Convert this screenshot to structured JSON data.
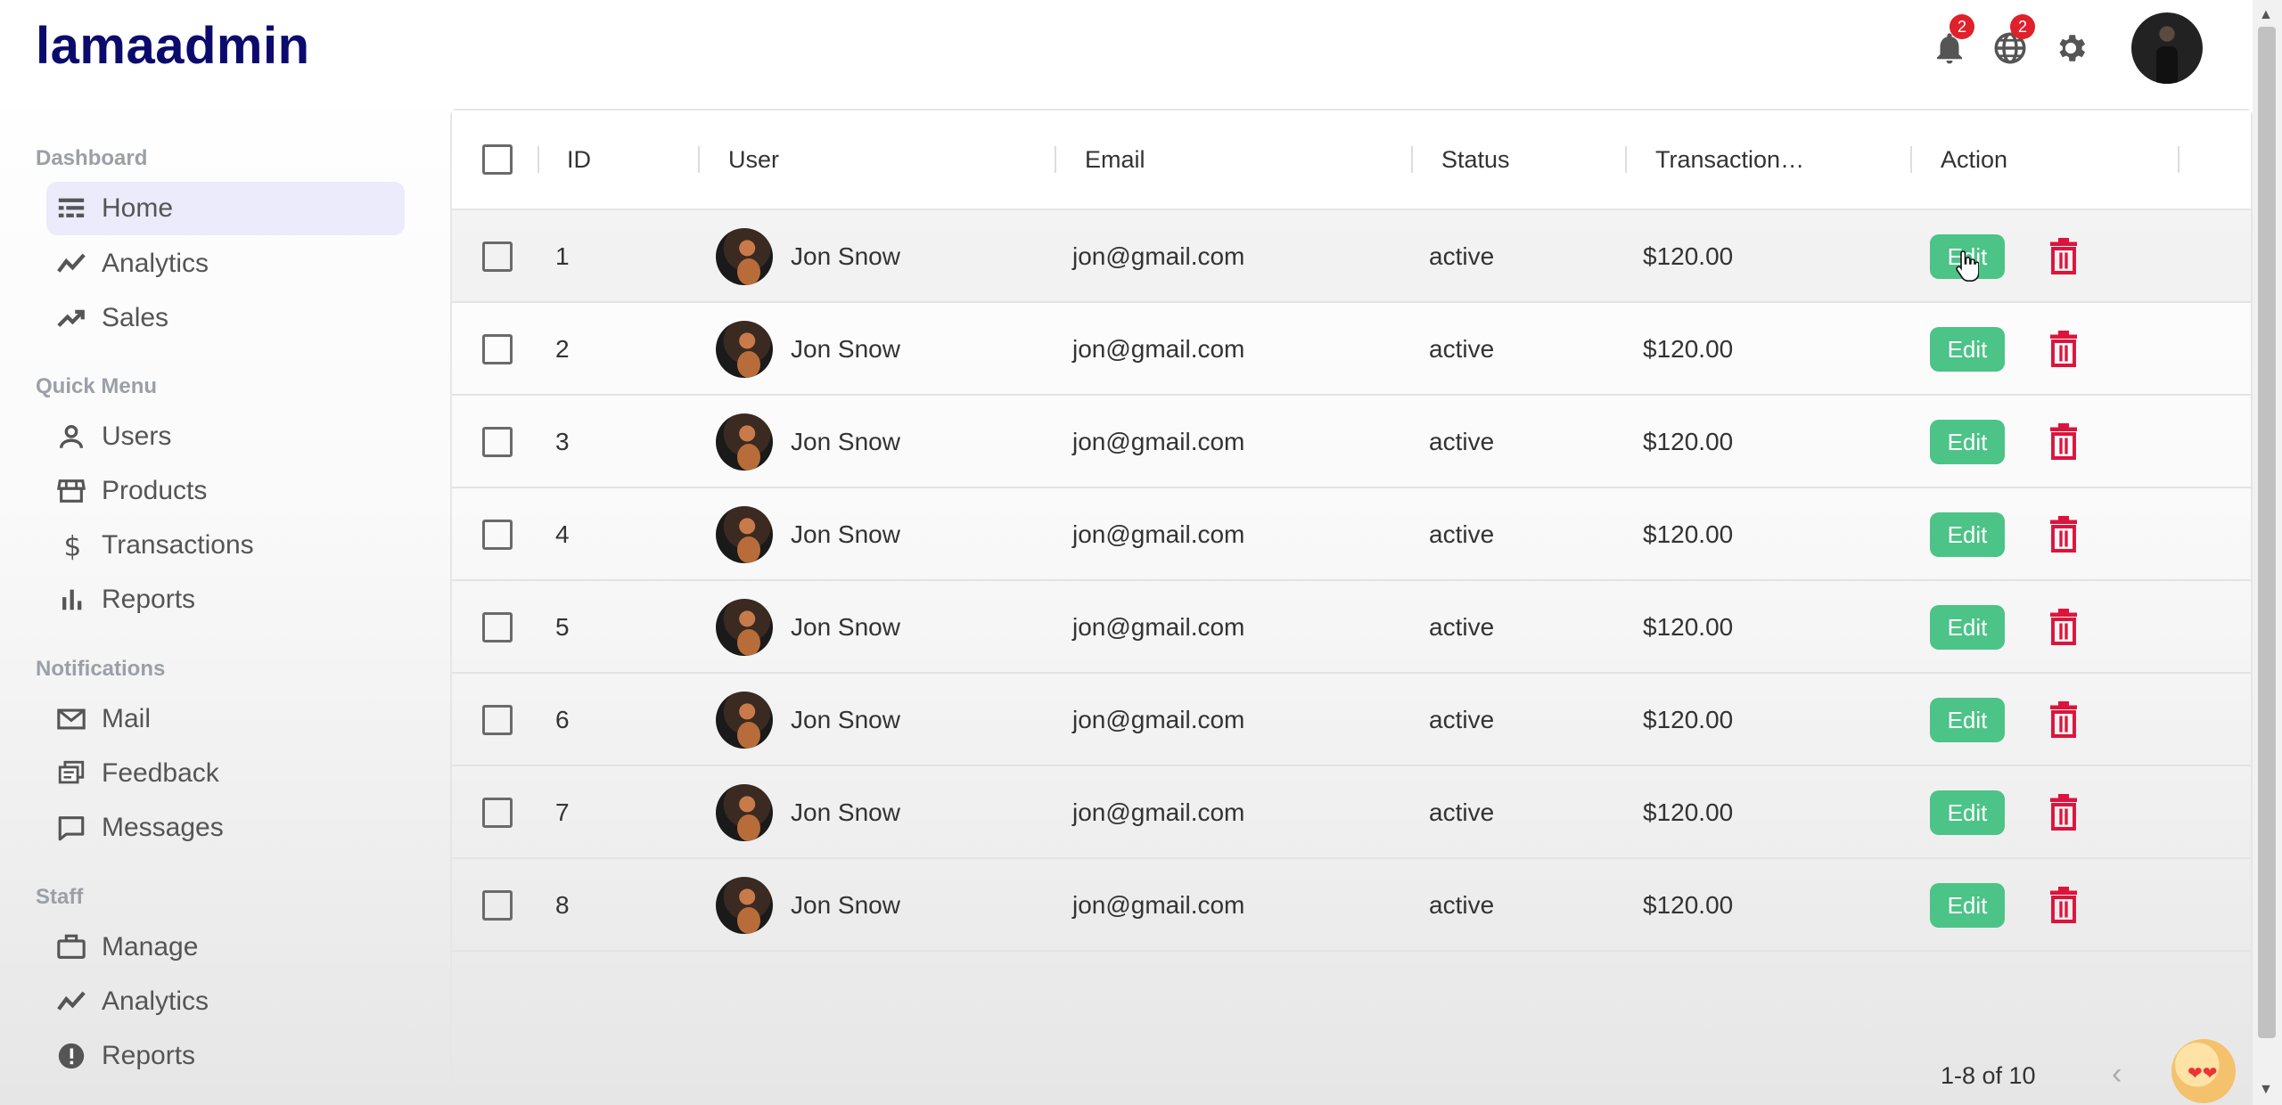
{
  "app": {
    "logo": "lamaadmin"
  },
  "topbar": {
    "notifications_badge": "2",
    "language_badge": "2"
  },
  "sidebar": {
    "sections": [
      {
        "title": "Dashboard",
        "items": [
          {
            "label": "Home",
            "icon": "dashboard-icon",
            "active": true
          },
          {
            "label": "Analytics",
            "icon": "analytics-icon"
          },
          {
            "label": "Sales",
            "icon": "trending-up-icon"
          }
        ]
      },
      {
        "title": "Quick Menu",
        "items": [
          {
            "label": "Users",
            "icon": "user-icon"
          },
          {
            "label": "Products",
            "icon": "storefront-icon"
          },
          {
            "label": "Transactions",
            "icon": "dollar-icon"
          },
          {
            "label": "Reports",
            "icon": "bar-chart-icon"
          }
        ]
      },
      {
        "title": "Notifications",
        "items": [
          {
            "label": "Mail",
            "icon": "mail-icon"
          },
          {
            "label": "Feedback",
            "icon": "feedback-icon"
          },
          {
            "label": "Messages",
            "icon": "chat-icon"
          }
        ]
      },
      {
        "title": "Staff",
        "items": [
          {
            "label": "Manage",
            "icon": "briefcase-icon"
          },
          {
            "label": "Analytics",
            "icon": "analytics-icon"
          },
          {
            "label": "Reports",
            "icon": "report-icon"
          }
        ]
      }
    ]
  },
  "table": {
    "columns": [
      "ID",
      "User",
      "Email",
      "Status",
      "Transaction…",
      "Action"
    ],
    "rows": [
      {
        "id": "1",
        "user": "Jon Snow",
        "email": "jon@gmail.com",
        "status": "active",
        "transaction": "$120.00",
        "edit": "Edit"
      },
      {
        "id": "2",
        "user": "Jon Snow",
        "email": "jon@gmail.com",
        "status": "active",
        "transaction": "$120.00",
        "edit": "Edit"
      },
      {
        "id": "3",
        "user": "Jon Snow",
        "email": "jon@gmail.com",
        "status": "active",
        "transaction": "$120.00",
        "edit": "Edit"
      },
      {
        "id": "4",
        "user": "Jon Snow",
        "email": "jon@gmail.com",
        "status": "active",
        "transaction": "$120.00",
        "edit": "Edit"
      },
      {
        "id": "5",
        "user": "Jon Snow",
        "email": "jon@gmail.com",
        "status": "active",
        "transaction": "$120.00",
        "edit": "Edit"
      },
      {
        "id": "6",
        "user": "Jon Snow",
        "email": "jon@gmail.com",
        "status": "active",
        "transaction": "$120.00",
        "edit": "Edit"
      },
      {
        "id": "7",
        "user": "Jon Snow",
        "email": "jon@gmail.com",
        "status": "active",
        "transaction": "$120.00",
        "edit": "Edit"
      },
      {
        "id": "8",
        "user": "Jon Snow",
        "email": "jon@gmail.com",
        "status": "active",
        "transaction": "$120.00",
        "edit": "Edit"
      }
    ],
    "pagination": {
      "range": "1-8 of 10"
    }
  },
  "colors": {
    "accent": "#0b0b6e",
    "edit_button": "#4cc387",
    "delete_icon": "#dc143c",
    "badge": "#e0202a"
  }
}
